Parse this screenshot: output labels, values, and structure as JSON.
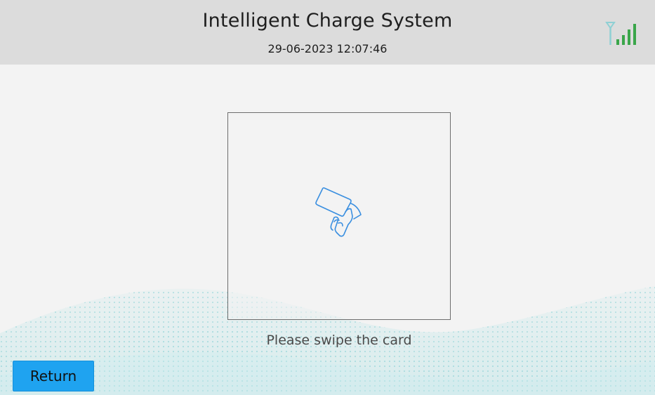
{
  "header": {
    "title": "Intelligent Charge System",
    "datetime": "29-06-2023 12:07:46",
    "signal_icon": "signal-strength-icon"
  },
  "main": {
    "card_icon": "hand-swipe-card-icon",
    "prompt": "Please swipe the card"
  },
  "footer": {
    "return_label": "Return"
  },
  "colors": {
    "header_bg": "#dcdcdc",
    "page_bg": "#f3f3f3",
    "signal_green": "#3aa64a",
    "icon_blue": "#3a8fe0",
    "button_blue": "#1fa3f0",
    "wave_teal": "#9fd8dc"
  }
}
